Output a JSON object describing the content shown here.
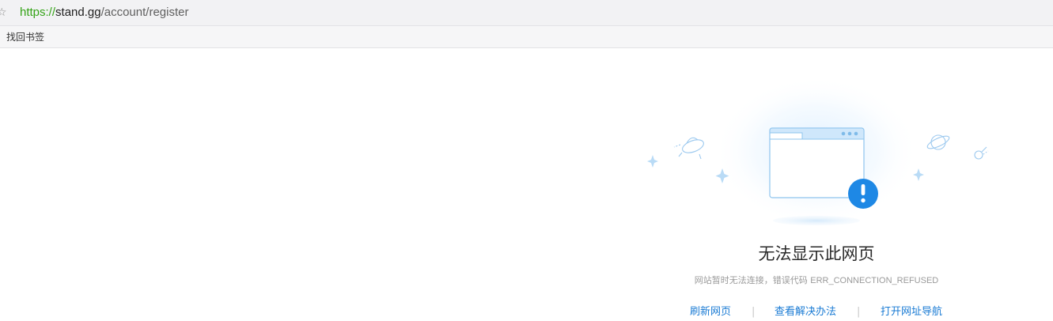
{
  "address_bar": {
    "scheme": "https://",
    "host": "stand.gg",
    "path": "/account/register",
    "star_icon": "star-icon"
  },
  "bookmarks_bar": {
    "items": [
      {
        "label": "找回书签"
      }
    ]
  },
  "error_page": {
    "title": "无法显示此网页",
    "description_prefix": "网站暂时无法连接，错误代码 ",
    "error_code": "ERR_CONNECTION_REFUSED",
    "actions": [
      {
        "label": "刷新网页"
      },
      {
        "label": "查看解决办法"
      },
      {
        "label": "打开网址导航"
      }
    ],
    "separator": "|",
    "colors": {
      "accent": "#1a7bd4",
      "badge": "#1e88e5",
      "illustration": "#a8d4f5"
    }
  }
}
